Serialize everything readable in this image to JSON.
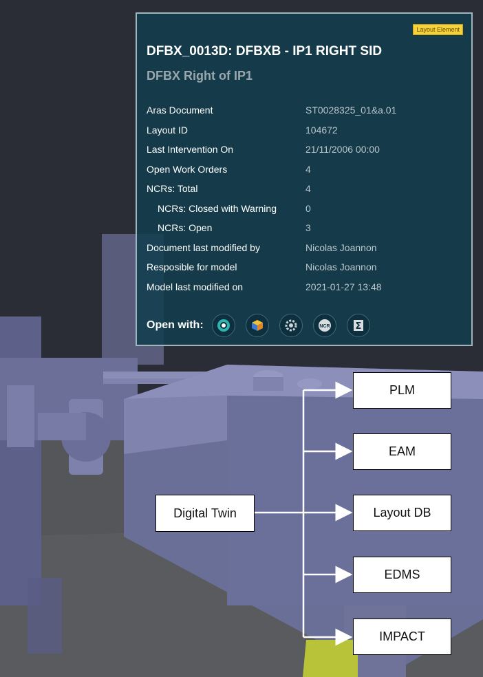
{
  "panel": {
    "badge": "Layout Element",
    "title": "DFBX_0013D: DFBXB - IP1 RIGHT SID",
    "subtitle": "DFBX Right of IP1",
    "rows": [
      {
        "label": "Aras Document",
        "value": "ST0028325_01&a.01"
      },
      {
        "label": "Layout ID",
        "value": "104672"
      },
      {
        "label": "Last Intervention On",
        "value": "21/11/2006 00:00"
      },
      {
        "label": "Open Work Orders",
        "value": "4"
      },
      {
        "label": "NCRs: Total",
        "value": "4"
      },
      {
        "label": "NCRs: Closed with Warning",
        "value": "0"
      },
      {
        "label": "NCRs: Open",
        "value": "3"
      },
      {
        "label": "Document last modified by",
        "value": "Nicolas Joannon"
      },
      {
        "label": "Resposible for model",
        "value": "Nicolas Joannon"
      },
      {
        "label": "Model last modified on",
        "value": "2021-01-27 13:48"
      }
    ],
    "open_with_label": "Open with:",
    "tools": [
      "gear-tool-icon",
      "package-tool-icon",
      "cog-tool-icon",
      "ncr-tool-icon",
      "sigma-tool-icon"
    ],
    "ncr_icon_text": "NCR",
    "sigma_icon_text": "Σ"
  },
  "diagram": {
    "source": "Digital Twin",
    "targets": [
      "PLM",
      "EAM",
      "Layout DB",
      "EDMS",
      "IMPACT"
    ]
  },
  "colors": {
    "panel_bg": "#123e4e",
    "badge_bg": "#f3d23a",
    "machine": "#6a6f98"
  }
}
